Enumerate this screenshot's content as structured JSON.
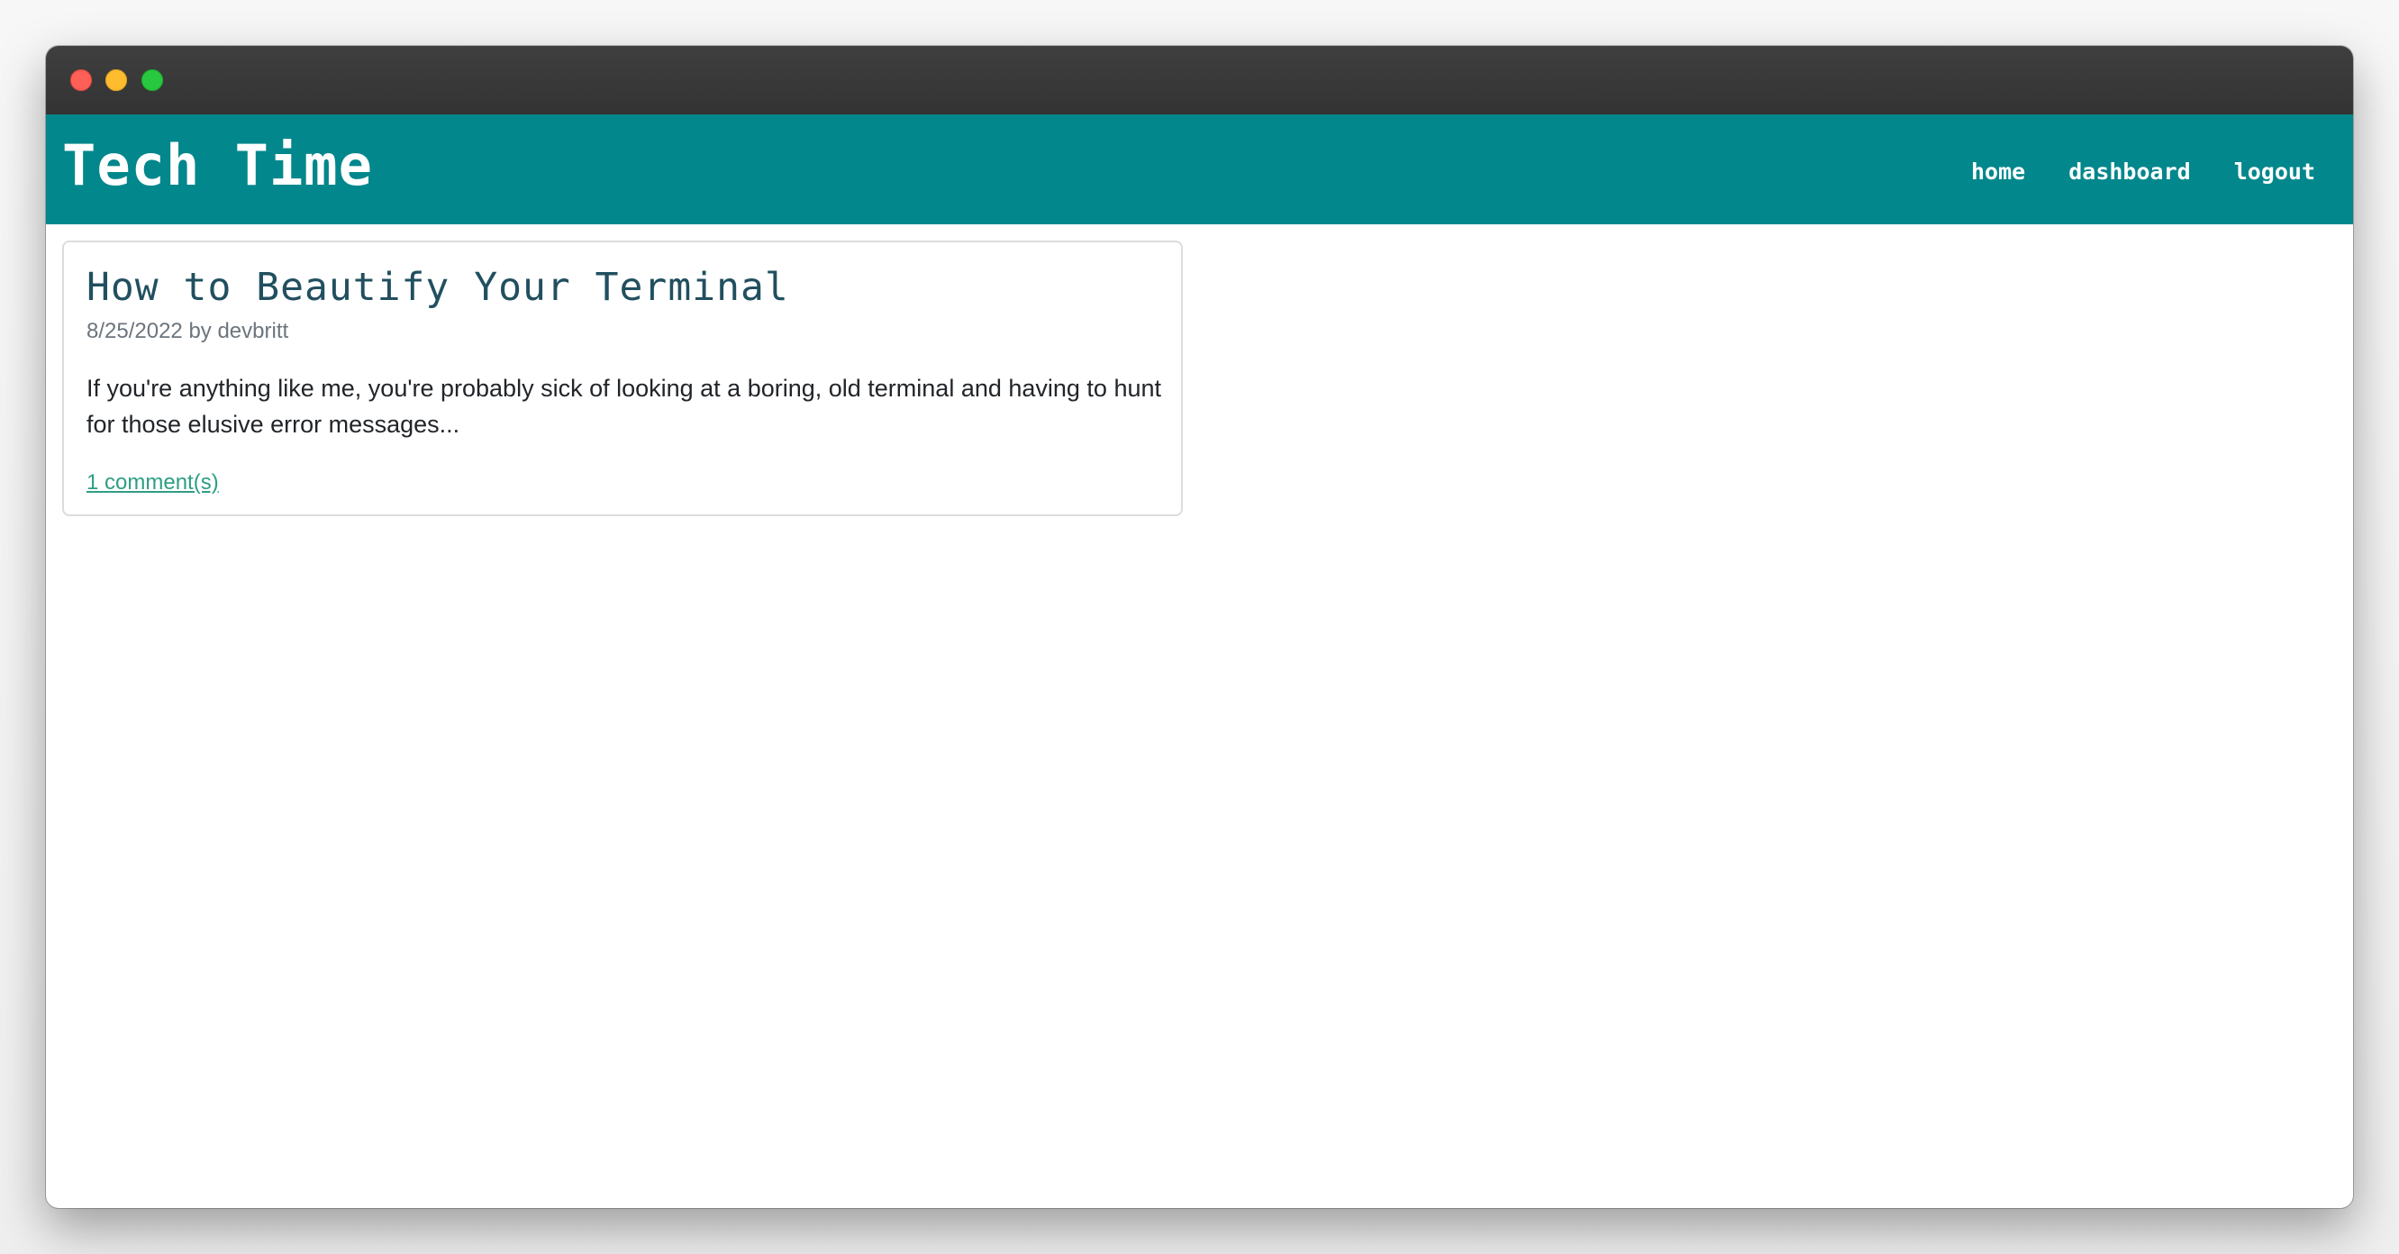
{
  "site": {
    "title": "Tech Time"
  },
  "nav": {
    "items": [
      "home",
      "dashboard",
      "logout"
    ]
  },
  "posts": [
    {
      "title": "How to Beautify Your Terminal",
      "date": "8/25/2022",
      "author": "devbritt",
      "meta": "8/25/2022 by devbritt",
      "excerpt": "If you're anything like me, you're probably sick of looking at a boring, old terminal and having to hunt for those elusive error messages...",
      "comments_link": "1 comment(s)"
    }
  ],
  "colors": {
    "navbar": "#02878c",
    "titlebar": "#383838",
    "post_title": "#214f5f",
    "link": "#2e9e84",
    "window_close": "#fe5f57",
    "window_minimize": "#febc2e",
    "window_maximize": "#28c840"
  }
}
